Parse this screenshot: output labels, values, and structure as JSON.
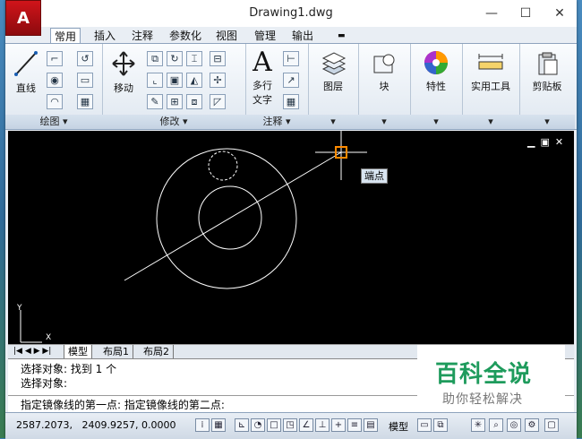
{
  "window": {
    "title": "Drawing1.dwg",
    "app_button": "A"
  },
  "tabs": [
    "常用",
    "插入",
    "注释",
    "参数化",
    "视图",
    "管理",
    "输出"
  ],
  "ribbon": {
    "draw": {
      "line": "直线",
      "label": "绘图"
    },
    "modify": {
      "move": "移动",
      "label": "修改"
    },
    "annotation": {
      "text_l1": "多行",
      "text_l2": "文字",
      "label": "注释",
      "big_a": "A"
    },
    "layers": "图层",
    "block": "块",
    "properties": "特性",
    "utilities": "实用工具",
    "clipboard": "剪贴板"
  },
  "canvas": {
    "tooltip": "端点",
    "ucs_x": "X",
    "ucs_y": "Y"
  },
  "layout_tabs": [
    "模型",
    "布局1",
    "布局2"
  ],
  "command": {
    "line1": "选择对象: 找到 1 个",
    "line2": "选择对象:",
    "line3": "指定镜像线的第一点: 指定镜像线的第二点:"
  },
  "status": {
    "coords": "2587.2073,   2409.9257, 0.0000",
    "model": "模型"
  },
  "watermark": {
    "title": "百科全说",
    "subtitle": "助你轻松解决"
  },
  "colors": {
    "accent": "#d0141a",
    "canvas": "#000000",
    "tooltip_bg": "#d8e4f0"
  }
}
